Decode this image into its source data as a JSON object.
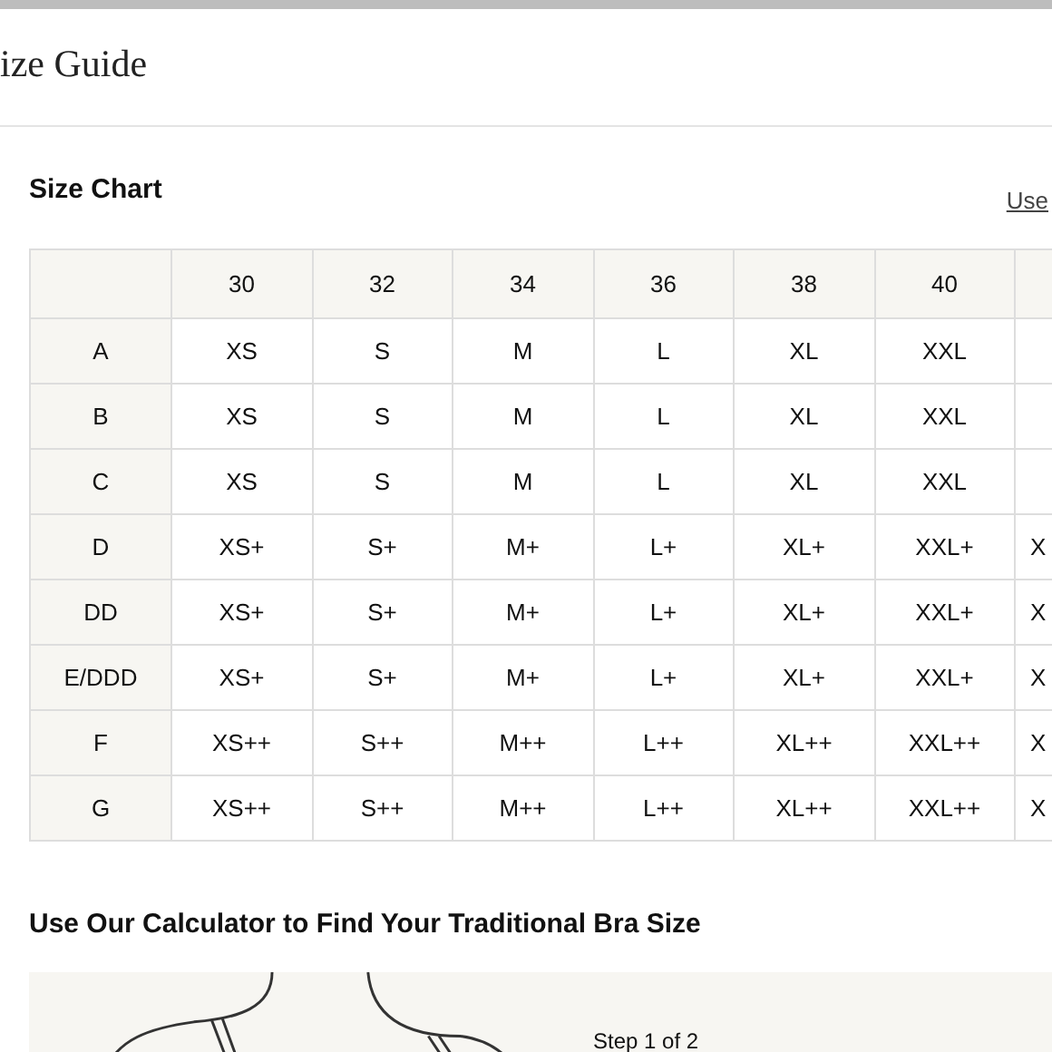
{
  "page_title": "ize Guide",
  "size_chart": {
    "title": "Size Chart",
    "link": "Use",
    "columns": [
      "",
      "30",
      "32",
      "34",
      "36",
      "38",
      "40",
      ""
    ],
    "rows": [
      {
        "cells": [
          "A",
          "XS",
          "S",
          "M",
          "L",
          "XL",
          "XXL",
          ""
        ]
      },
      {
        "cells": [
          "B",
          "XS",
          "S",
          "M",
          "L",
          "XL",
          "XXL",
          ""
        ]
      },
      {
        "cells": [
          "C",
          "XS",
          "S",
          "M",
          "L",
          "XL",
          "XXL",
          ""
        ]
      },
      {
        "cells": [
          "D",
          "XS+",
          "S+",
          "M+",
          "L+",
          "XL+",
          "XXL+",
          "X"
        ]
      },
      {
        "cells": [
          "DD",
          "XS+",
          "S+",
          "M+",
          "L+",
          "XL+",
          "XXL+",
          "X"
        ]
      },
      {
        "cells": [
          "E/DDD",
          "XS+",
          "S+",
          "M+",
          "L+",
          "XL+",
          "XXL+",
          "X"
        ]
      },
      {
        "cells": [
          "F",
          "XS++",
          "S++",
          "M++",
          "L++",
          "XL++",
          "XXL++",
          "X"
        ]
      },
      {
        "cells": [
          "G",
          "XS++",
          "S++",
          "M++",
          "L++",
          "XL++",
          "XXL++",
          "X"
        ]
      }
    ]
  },
  "calculator": {
    "title": "Use Our Calculator to Find Your Traditional Bra Size",
    "step": "Step 1 of 2"
  }
}
